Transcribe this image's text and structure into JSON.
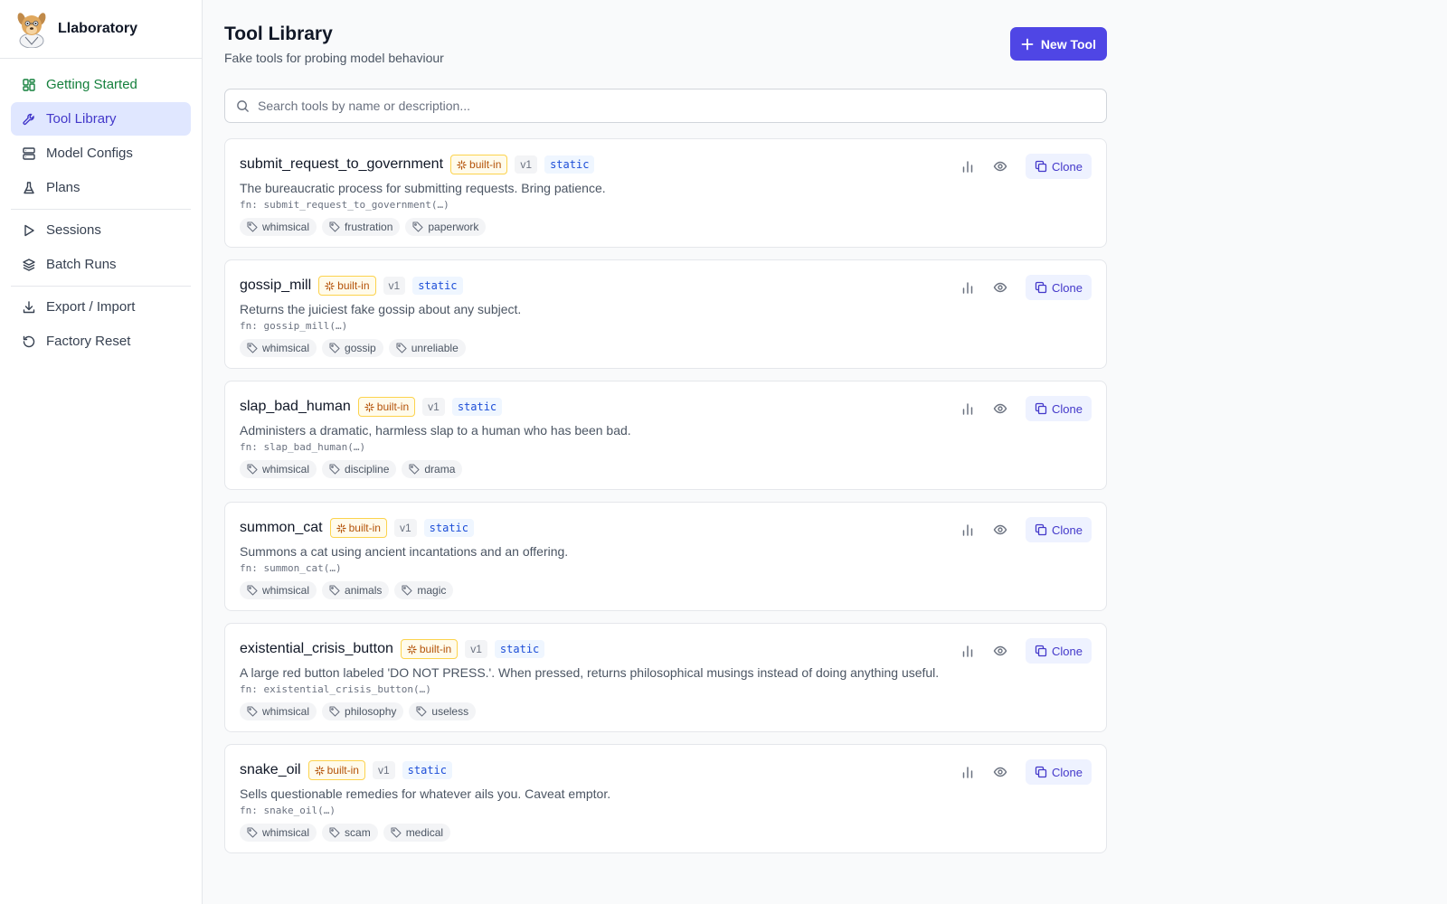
{
  "app": {
    "name": "Llaboratory"
  },
  "sidebar": {
    "items": [
      {
        "label": "Getting Started",
        "icon": "dashboard-icon"
      },
      {
        "label": "Tool Library",
        "icon": "wrench-icon"
      },
      {
        "label": "Model Configs",
        "icon": "server-icon"
      },
      {
        "label": "Plans",
        "icon": "flask-icon"
      },
      {
        "label": "Sessions",
        "icon": "play-icon"
      },
      {
        "label": "Batch Runs",
        "icon": "layers-icon"
      },
      {
        "label": "Export / Import",
        "icon": "download-icon"
      },
      {
        "label": "Factory Reset",
        "icon": "reset-icon"
      }
    ],
    "active": "Tool Library"
  },
  "header": {
    "title": "Tool Library",
    "subtitle": "Fake tools for probing model behaviour",
    "new_button": "New Tool"
  },
  "search": {
    "placeholder": "Search tools by name or description..."
  },
  "colors": {
    "accent": "#4f46e5",
    "builtin": "#b45309",
    "green": "#15803d"
  },
  "tools": [
    {
      "name": "submit_request_to_government",
      "builtin": "built-in",
      "version": "v1",
      "mode": "static",
      "description": "The bureaucratic process for submitting requests. Bring patience.",
      "fn": "fn: submit_request_to_government(…)",
      "tags": [
        "whimsical",
        "frustration",
        "paperwork"
      ],
      "clone": "Clone"
    },
    {
      "name": "gossip_mill",
      "builtin": "built-in",
      "version": "v1",
      "mode": "static",
      "description": "Returns the juiciest fake gossip about any subject.",
      "fn": "fn: gossip_mill(…)",
      "tags": [
        "whimsical",
        "gossip",
        "unreliable"
      ],
      "clone": "Clone"
    },
    {
      "name": "slap_bad_human",
      "builtin": "built-in",
      "version": "v1",
      "mode": "static",
      "description": "Administers a dramatic, harmless slap to a human who has been bad.",
      "fn": "fn: slap_bad_human(…)",
      "tags": [
        "whimsical",
        "discipline",
        "drama"
      ],
      "clone": "Clone"
    },
    {
      "name": "summon_cat",
      "builtin": "built-in",
      "version": "v1",
      "mode": "static",
      "description": "Summons a cat using ancient incantations and an offering.",
      "fn": "fn: summon_cat(…)",
      "tags": [
        "whimsical",
        "animals",
        "magic"
      ],
      "clone": "Clone"
    },
    {
      "name": "existential_crisis_button",
      "builtin": "built-in",
      "version": "v1",
      "mode": "static",
      "description": "A large red button labeled 'DO NOT PRESS.'. When pressed, returns philosophical musings instead of doing anything useful.",
      "fn": "fn: existential_crisis_button(…)",
      "tags": [
        "whimsical",
        "philosophy",
        "useless"
      ],
      "clone": "Clone"
    },
    {
      "name": "snake_oil",
      "builtin": "built-in",
      "version": "v1",
      "mode": "static",
      "description": "Sells questionable remedies for whatever ails you. Caveat emptor.",
      "fn": "fn: snake_oil(…)",
      "tags": [
        "whimsical",
        "scam",
        "medical"
      ],
      "clone": "Clone"
    }
  ]
}
